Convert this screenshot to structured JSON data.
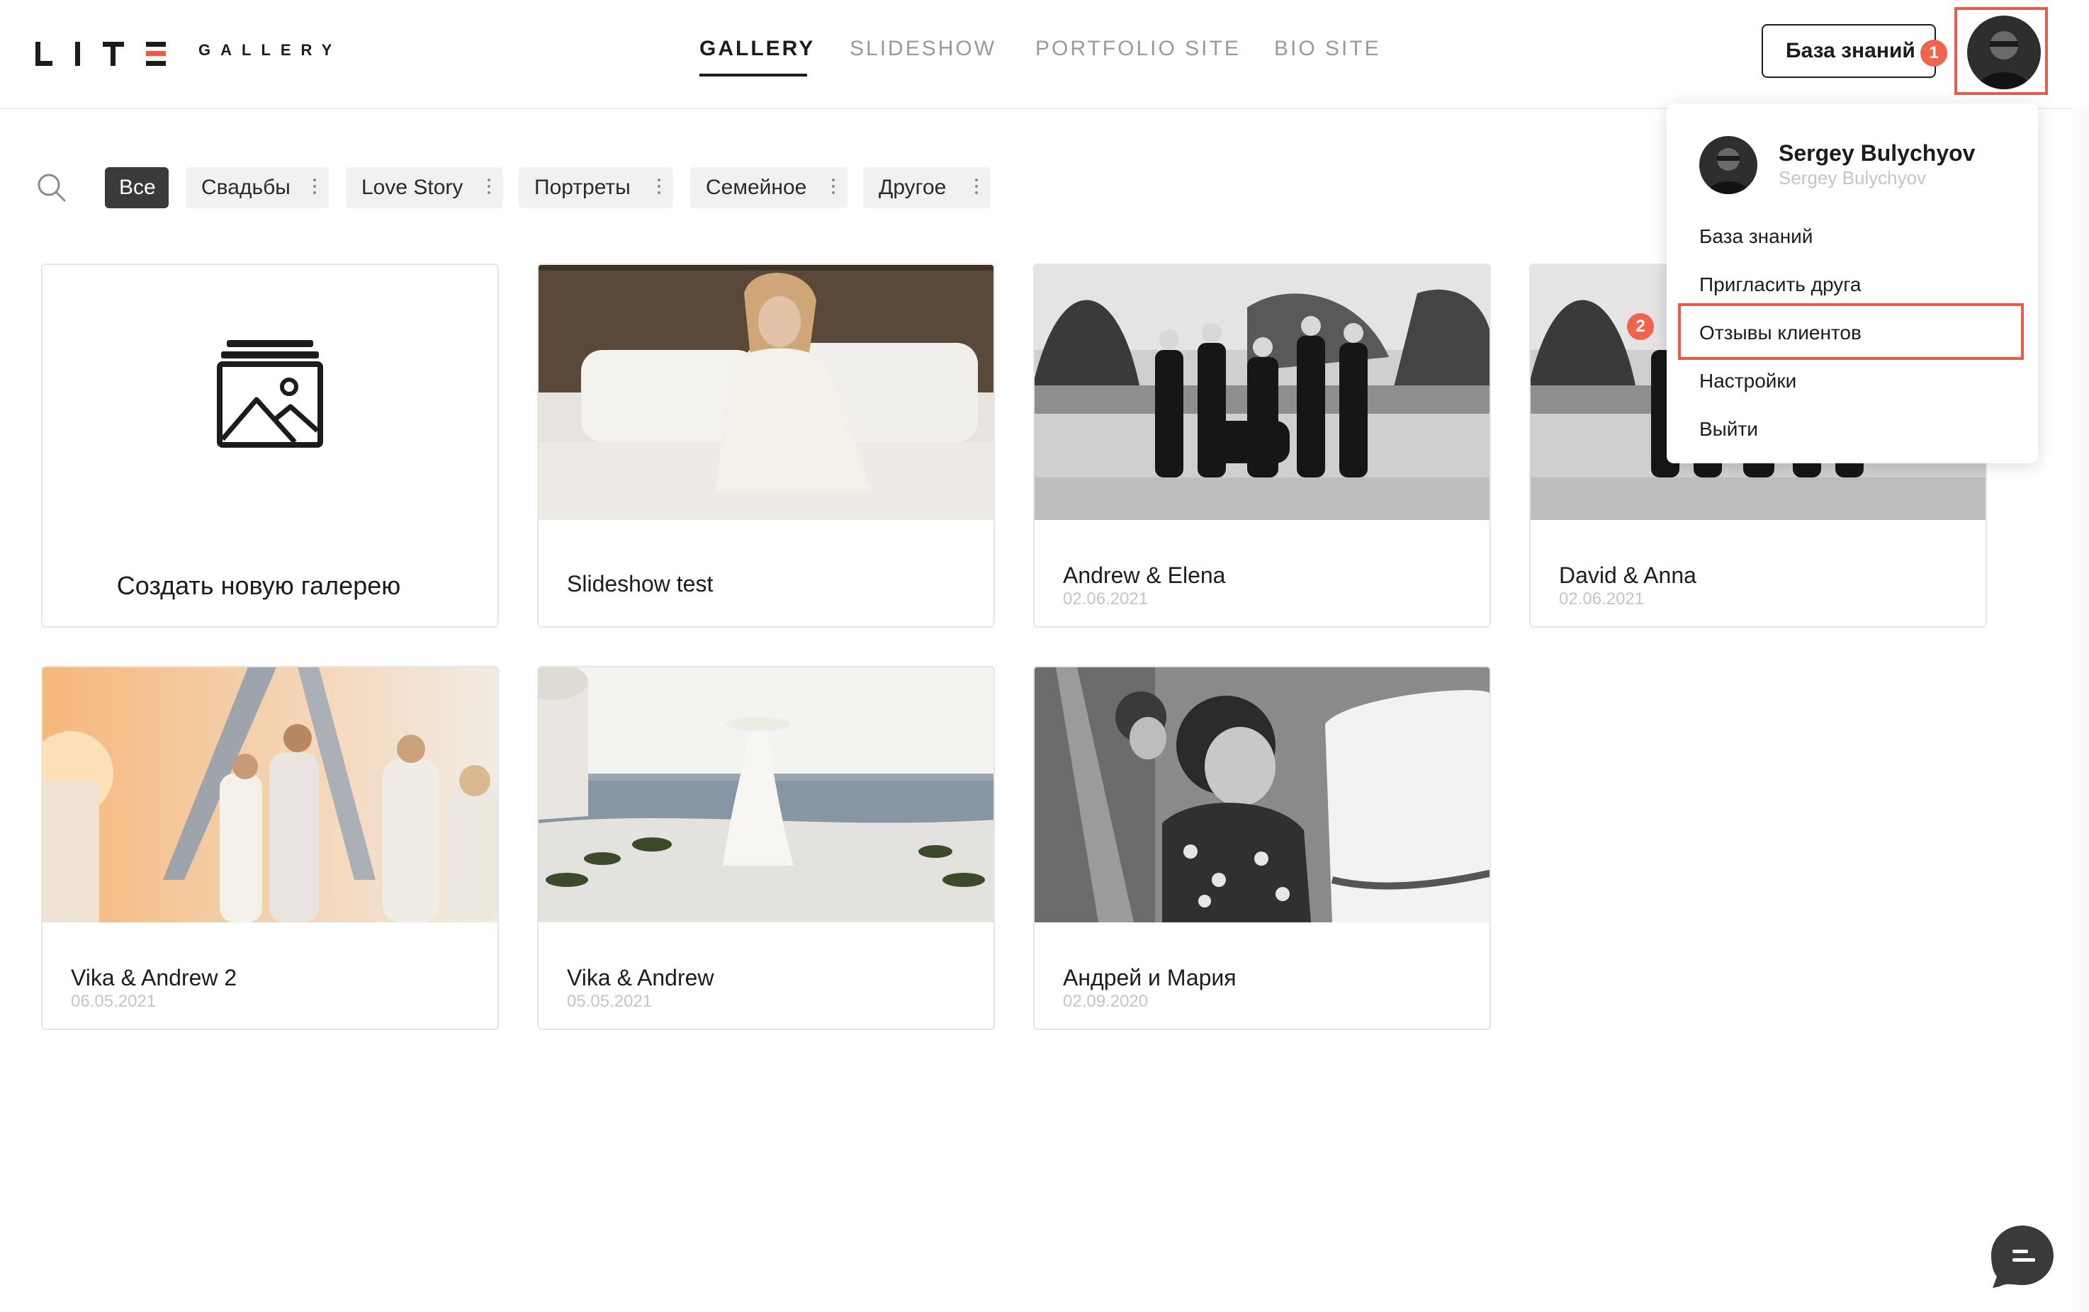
{
  "brand": {
    "logo_text": "LITE",
    "logo_sub": "GALLERY"
  },
  "nav": {
    "items": [
      {
        "label": "GALLERY",
        "active": true
      },
      {
        "label": "SLIDESHOW",
        "active": false
      },
      {
        "label": "PORTFOLIO SITE",
        "active": false
      },
      {
        "label": "BIO SITE",
        "active": false
      }
    ]
  },
  "header": {
    "knowledge_base_button": "База знаний",
    "marker_1": "1",
    "marker_2": "2"
  },
  "filters": {
    "search_icon": "search-icon",
    "items": [
      "Все",
      "Свадьбы",
      "Love Story",
      "Портреты",
      "Семейное",
      "Другое"
    ],
    "active": "Все"
  },
  "new_gallery": {
    "label": "Создать новую галерею",
    "icon": "gallery-stack-icon"
  },
  "galleries": [
    {
      "title": "Slideshow test",
      "date": ""
    },
    {
      "title": "Andrew & Elena",
      "date": "02.06.2021"
    },
    {
      "title": "David & Anna",
      "date": "02.06.2021"
    },
    {
      "title": "Vika & Andrew 2",
      "date": "06.05.2021"
    },
    {
      "title": "Vika & Andrew",
      "date": "05.05.2021"
    },
    {
      "title": "Андрей и Мария",
      "date": "02.09.2020"
    }
  ],
  "user_menu": {
    "name": "Sergey Bulychyov",
    "subtitle": "Sergey Bulychyov",
    "items": [
      "База знаний",
      "Пригласить друга",
      "Отзывы клиентов",
      "Настройки",
      "Выйти"
    ],
    "highlighted": "Отзывы клиентов"
  },
  "colors": {
    "accent": "#ec5b4a",
    "marker": "#f0644e",
    "active_filter": "#3a3a3a",
    "text": "#1c1c1c",
    "muted": "#9a9a9a"
  },
  "chat_icon": "chat-bubble-icon"
}
